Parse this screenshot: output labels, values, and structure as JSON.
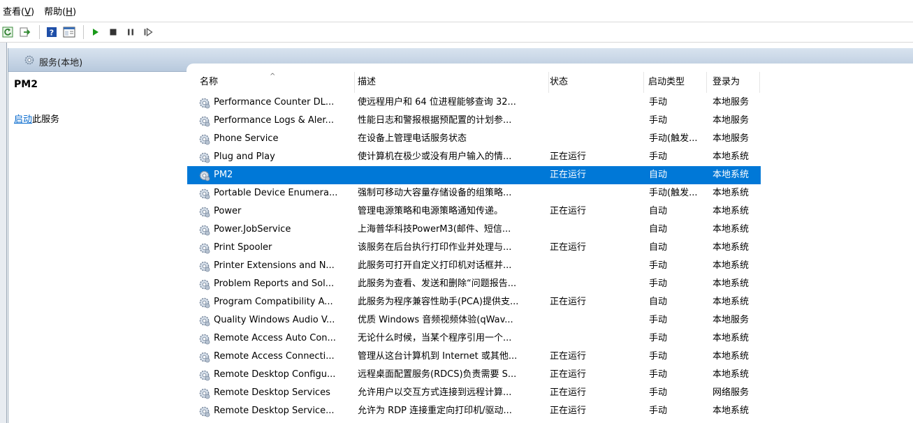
{
  "menubar": {
    "view": "查看",
    "view_key": "V",
    "help": "帮助",
    "help_key": "H"
  },
  "toolbar": {
    "icons": [
      "refresh-icon",
      "export-icon",
      "help-icon",
      "properties-icon",
      "start-service-icon",
      "stop-service-icon",
      "pause-service-icon",
      "restart-service-icon"
    ]
  },
  "panel": {
    "header_title": "服务(本地)"
  },
  "left": {
    "service_name": "PM2",
    "start_link": "启动",
    "start_suffix": "此服务"
  },
  "columns": {
    "name": "名称",
    "description": "描述",
    "status": "状态",
    "startup_type": "启动类型",
    "logon_as": "登录为"
  },
  "rows": [
    {
      "name": "Performance Counter DL...",
      "description": "使远程用户和 64 位进程能够查询 32...",
      "status": "",
      "startup_type": "手动",
      "logon_as": "本地服务"
    },
    {
      "name": "Performance Logs & Aler...",
      "description": "性能日志和警报根据预配置的计划参...",
      "status": "",
      "startup_type": "手动",
      "logon_as": "本地服务"
    },
    {
      "name": "Phone Service",
      "description": "在设备上管理电话服务状态",
      "status": "",
      "startup_type": "手动(触发...",
      "logon_as": "本地服务"
    },
    {
      "name": "Plug and Play",
      "description": "使计算机在极少或没有用户输入的情...",
      "status": "正在运行",
      "startup_type": "手动",
      "logon_as": "本地系统"
    },
    {
      "name": "PM2",
      "description": "",
      "status": "正在运行",
      "startup_type": "自动",
      "logon_as": "本地系统"
    },
    {
      "name": "Portable Device Enumera...",
      "description": "强制可移动大容量存储设备的组策略...",
      "status": "",
      "startup_type": "手动(触发...",
      "logon_as": "本地系统"
    },
    {
      "name": "Power",
      "description": "管理电源策略和电源策略通知传递。",
      "status": "正在运行",
      "startup_type": "自动",
      "logon_as": "本地系统"
    },
    {
      "name": "Power.JobService",
      "description": "上海普华科技PowerM3(邮件、短信...",
      "status": "",
      "startup_type": "自动",
      "logon_as": "本地系统"
    },
    {
      "name": "Print Spooler",
      "description": "该服务在后台执行打印作业并处理与...",
      "status": "正在运行",
      "startup_type": "自动",
      "logon_as": "本地系统"
    },
    {
      "name": "Printer Extensions and N...",
      "description": "此服务可打开自定义打印机对话框并...",
      "status": "",
      "startup_type": "手动",
      "logon_as": "本地系统"
    },
    {
      "name": "Problem Reports and Sol...",
      "description": "此服务为查看、发送和删除“问题报告...",
      "status": "",
      "startup_type": "手动",
      "logon_as": "本地系统"
    },
    {
      "name": "Program Compatibility A...",
      "description": "此服务为程序兼容性助手(PCA)提供支...",
      "status": "正在运行",
      "startup_type": "自动",
      "logon_as": "本地系统"
    },
    {
      "name": "Quality Windows Audio V...",
      "description": "优质 Windows 音频视频体验(qWav...",
      "status": "",
      "startup_type": "手动",
      "logon_as": "本地服务"
    },
    {
      "name": "Remote Access Auto Con...",
      "description": "无论什么时候，当某个程序引用一个...",
      "status": "",
      "startup_type": "手动",
      "logon_as": "本地系统"
    },
    {
      "name": "Remote Access Connecti...",
      "description": "管理从这台计算机到 Internet 或其他...",
      "status": "正在运行",
      "startup_type": "手动",
      "logon_as": "本地系统"
    },
    {
      "name": "Remote Desktop Configu...",
      "description": "远程桌面配置服务(RDCS)负责需要 S...",
      "status": "正在运行",
      "startup_type": "手动",
      "logon_as": "本地系统"
    },
    {
      "name": "Remote Desktop Services",
      "description": "允许用户以交互方式连接到远程计算...",
      "status": "正在运行",
      "startup_type": "手动",
      "logon_as": "网络服务"
    },
    {
      "name": "Remote Desktop Service...",
      "description": "允许为 RDP 连接重定向打印机/驱动...",
      "status": "正在运行",
      "startup_type": "手动",
      "logon_as": "本地系统"
    }
  ],
  "selected_row": "PM2",
  "colors": {
    "selection": "#0078d7",
    "link": "#0066cc",
    "header_gradient_top": "#d8e3ef",
    "header_gradient_bottom": "#b8c9dd"
  }
}
